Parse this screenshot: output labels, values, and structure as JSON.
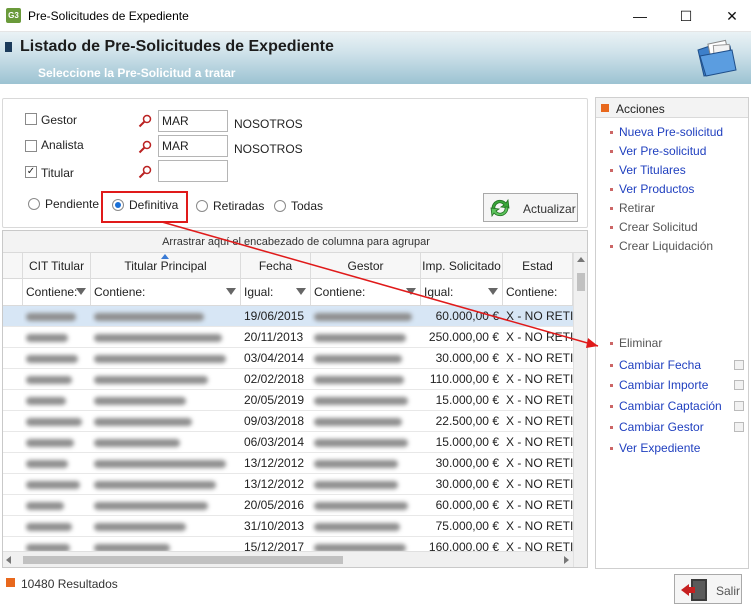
{
  "window": {
    "app_icon": "G3",
    "title": "Pre-Solicitudes de Expediente",
    "minimize": "—",
    "maximize": "☐",
    "close": "✕"
  },
  "header": {
    "title": "Listado de Pre-Solicitudes de Expediente",
    "subtitle": "Seleccione la Pre-Solicitud a tratar"
  },
  "filters": {
    "gestor": {
      "label": "Gestor",
      "checked": false,
      "value": "MAR",
      "name": "NOSOTROS"
    },
    "analista": {
      "label": "Analista",
      "checked": false,
      "value": "MAR",
      "name": "NOSOTROS"
    },
    "titular": {
      "label": "Titular",
      "checked": true,
      "value": ""
    },
    "radios": [
      {
        "label": "Pendiente",
        "selected": false
      },
      {
        "label": "Definitiva",
        "selected": true
      },
      {
        "label": "Retiradas",
        "selected": false
      },
      {
        "label": "Todas",
        "selected": false
      }
    ],
    "refresh_label": "Actualizar"
  },
  "grid": {
    "group_hint": "Arrastrar aquí el encabezado de columna para agrupar",
    "columns": [
      "CIT Titular",
      "Titular Principal",
      "Fecha",
      "Gestor",
      "Imp. Solicitado",
      "Estad"
    ],
    "filters": [
      "Contiene:",
      "Contiene:",
      "Igual:",
      "Contiene:",
      "Igual:",
      "Contiene:"
    ],
    "rows": [
      {
        "fecha": "19/06/2015",
        "importe": "60.000,00 €",
        "estado": "X - NO RETIRA"
      },
      {
        "fecha": "20/11/2013",
        "importe": "250.000,00 €",
        "estado": "X - NO RETIRA"
      },
      {
        "fecha": "03/04/2014",
        "importe": "30.000,00 €",
        "estado": "X - NO RETIRA"
      },
      {
        "fecha": "02/02/2018",
        "importe": "110.000,00 €",
        "estado": "X - NO RETIRA"
      },
      {
        "fecha": "20/05/2019",
        "importe": "15.000,00 €",
        "estado": "X - NO RETIRA"
      },
      {
        "fecha": "09/03/2018",
        "importe": "22.500,00 €",
        "estado": "X - NO RETIRA"
      },
      {
        "fecha": "06/03/2014",
        "importe": "15.000,00 €",
        "estado": "X - NO RETIRA"
      },
      {
        "fecha": "13/12/2012",
        "importe": "30.000,00 €",
        "estado": "X - NO RETIRA"
      },
      {
        "fecha": "13/12/2012",
        "importe": "30.000,00 €",
        "estado": "X - NO RETIRA"
      },
      {
        "fecha": "20/05/2016",
        "importe": "60.000,00 €",
        "estado": "X - NO RETIRA"
      },
      {
        "fecha": "31/10/2013",
        "importe": "75.000,00 €",
        "estado": "X - NO RETIRA"
      },
      {
        "fecha": "15/12/2017",
        "importe": "160.000,00 €",
        "estado": "X - NO RETIRA"
      }
    ]
  },
  "actions": {
    "title": "Acciones",
    "group1": [
      {
        "label": "Nueva Pre-solicitud",
        "enabled": true
      },
      {
        "label": "Ver Pre-solicitud",
        "enabled": true
      },
      {
        "label": "Ver Titulares",
        "enabled": true
      },
      {
        "label": "Ver Productos",
        "enabled": true
      },
      {
        "label": "Retirar",
        "enabled": false
      },
      {
        "label": "Crear Solicitud",
        "enabled": false
      },
      {
        "label": "Crear Liquidación",
        "enabled": false
      }
    ],
    "group2": [
      {
        "label": "Eliminar",
        "enabled": false
      },
      {
        "label": "Cambiar Fecha",
        "enabled": true
      },
      {
        "label": "Cambiar Importe",
        "enabled": true
      },
      {
        "label": "Cambiar Captación",
        "enabled": true
      },
      {
        "label": "Cambiar Gestor",
        "enabled": true
      },
      {
        "label": "Ver Expediente",
        "enabled": true
      }
    ]
  },
  "footer": {
    "results": "10480 Resultados",
    "exit_label": "Salir"
  },
  "colors": {
    "accent_red": "#e01a1a",
    "link_blue": "#1f3fbf",
    "header_blue": "#9cc3d2",
    "selected_row": "#d7e6f5"
  }
}
